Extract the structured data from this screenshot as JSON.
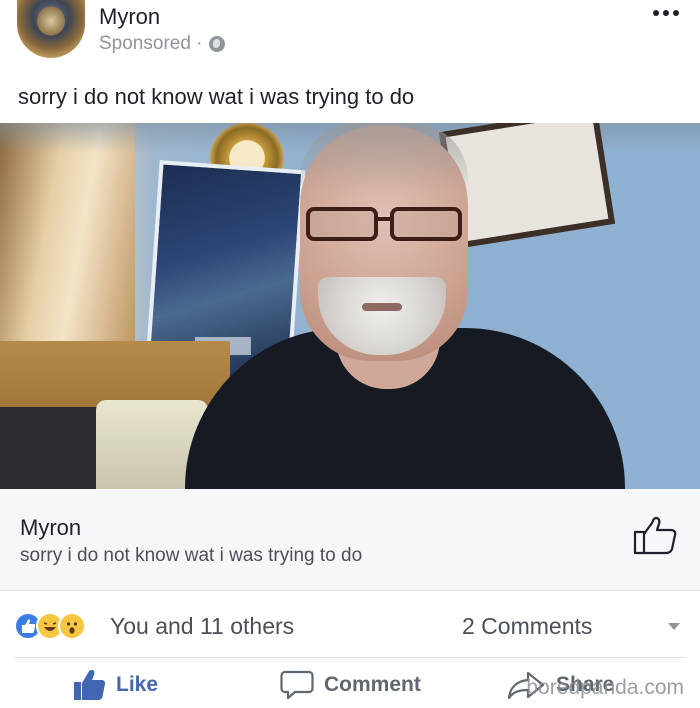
{
  "post": {
    "author": "Myron",
    "sponsored_label": "Sponsored ·",
    "text": "sorry i do not know wat i was trying to do"
  },
  "icons": {
    "avatar": "profile-photo",
    "privacy": "globe-icon",
    "menu": "more-options-icon",
    "card_like": "thumbs-up-outline-icon",
    "reactions": [
      "like-reaction-icon",
      "haha-reaction-icon",
      "wow-reaction-icon"
    ],
    "like": "thumbs-up-filled-icon",
    "comment": "speech-bubble-icon",
    "share": "share-arrow-icon"
  },
  "link_card": {
    "title": "Myron",
    "description": "sorry i do not know wat i was trying to do"
  },
  "stats": {
    "reactions_label": "You and 11 others",
    "comments_label": "2 Comments"
  },
  "actions": {
    "like": "Like",
    "comment": "Comment",
    "share": "Share"
  },
  "watermark": "boredpanda.com",
  "colors": {
    "link_blue": "#4267b2",
    "text_primary": "#1d2129",
    "text_secondary": "#90949c",
    "like_reaction": "#3b7ce6",
    "emoji_reaction": "#f7c744"
  }
}
